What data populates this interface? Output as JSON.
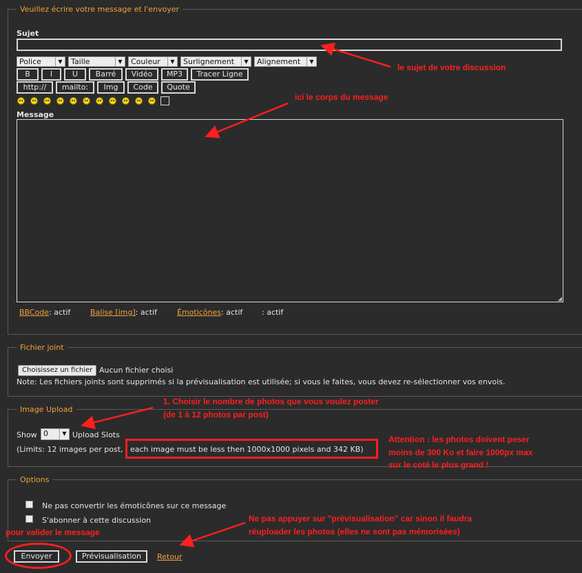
{
  "message_section": {
    "legend": "Veuillez écrire votre message et l'envoyer",
    "subject_label": "Sujet",
    "subject_value": "",
    "message_label": "Message"
  },
  "toolbar": {
    "selects": [
      "Police",
      "Taille",
      "Couleur",
      "Surlignement",
      "Alignement"
    ],
    "row1_buttons": [
      "B",
      "I",
      "U",
      "Barré",
      "Vidéo",
      "MP3",
      "Tracer Ligne"
    ],
    "row2_buttons": [
      "http://",
      "mailto:",
      "Img",
      "Code",
      "Quote"
    ]
  },
  "status": {
    "bbcode_link": "BBCode",
    "bbcode_state": ": actif",
    "img_link": "Balise [img]",
    "img_state": ": actif",
    "emoticons_link": "Émoticônes",
    "emoticons_state": ": actif",
    "extra_state": ": actif"
  },
  "attachment": {
    "legend": "Fichier joint",
    "choose_button": "Choisissez un fichier",
    "no_file": "Aucun fichier choisi",
    "note": "Note: Les fichiers joints sont supprimés si la prévisualisation est utilisée; si vous le faites, vous devez re-sélectionner vos envois."
  },
  "upload": {
    "legend": "Image Upload",
    "show_label": "Show",
    "show_value": "0",
    "slots_label": "Upload Slots",
    "limits_part1": "(Limits: 12 images per post,",
    "limits_part2": "each image must be less then 1000x1000 pixels and 342 KB)"
  },
  "options": {
    "legend": "Options",
    "opt1": "Ne pas convertir les émoticônes sur ce message",
    "opt2": "S'abonner à cette discussion"
  },
  "actions": {
    "send": "Envoyer",
    "preview": "Prévisualisation",
    "back": "Retour"
  },
  "annotations": {
    "subject_note": "le sujet de votre discussion",
    "body_note": "ici le corps du message",
    "upload_note_1": "1. Choisir le nombre de photos que vous voulez poster",
    "upload_note_2": "(de 1 à 12 photos par post)",
    "warn_1": "Attention : les photos doivent peser",
    "warn_2": "moins de 300 Ko et faire 1000px max",
    "warn_3": "sur le coté le plus grand !",
    "preview_note_1": "Ne pas appuyer sur \"prévisualisation\" car sinon il faudra",
    "preview_note_2": "réuploader les photos (elles ne sont pas mémorisées)",
    "send_note": "pour valider le message"
  },
  "colors": {
    "background": "#2b2b2b",
    "legend": "#f0a23a",
    "annotation": "#ff1f1f"
  }
}
